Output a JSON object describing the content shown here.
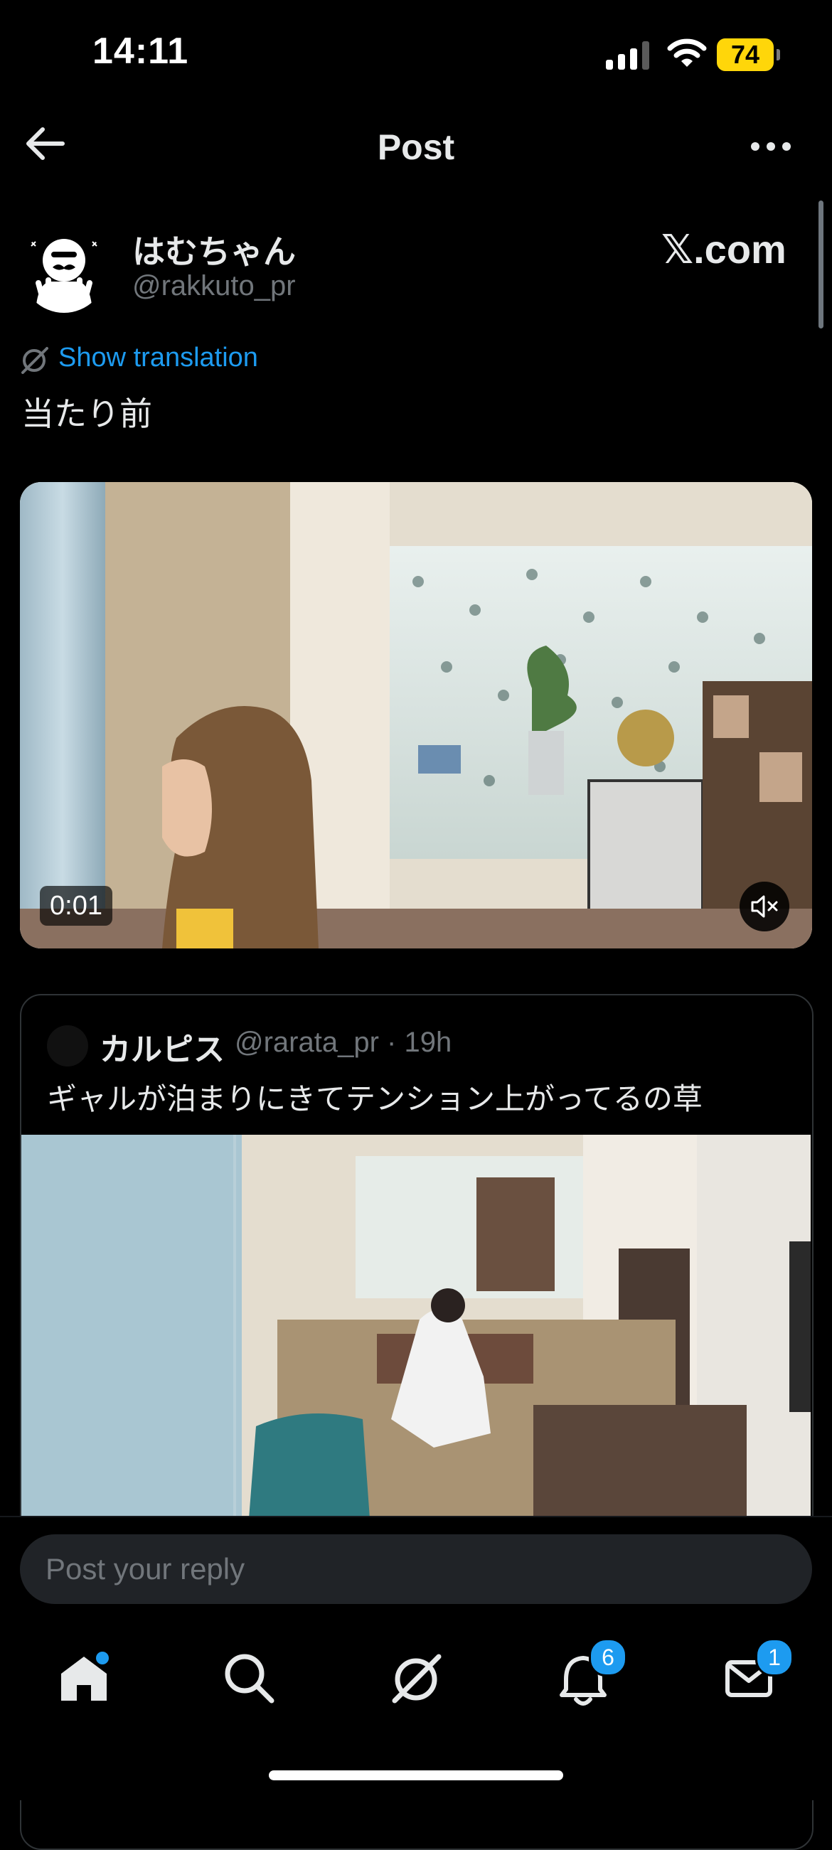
{
  "status_bar": {
    "time": "14:11",
    "battery": "74"
  },
  "header": {
    "title": "Post"
  },
  "post": {
    "author_name": "はむちゃん",
    "author_handle": "@rakkuto_pr",
    "source": "𝕏.com",
    "translation_link": "Show translation",
    "text": "当たり前",
    "video": {
      "duration": "0:01"
    }
  },
  "quote": {
    "author_name": "カルピス",
    "author_handle": "@rarata_pr · 19h",
    "text": "ギャルが泊まりにきてテンション上がってるの草"
  },
  "reply": {
    "placeholder": "Post your reply"
  },
  "tabs": {
    "notifications_badge": "6",
    "messages_badge": "1"
  },
  "colors": {
    "accent": "#1d9bf0",
    "battery": "#ffd60a",
    "background": "#000000"
  }
}
